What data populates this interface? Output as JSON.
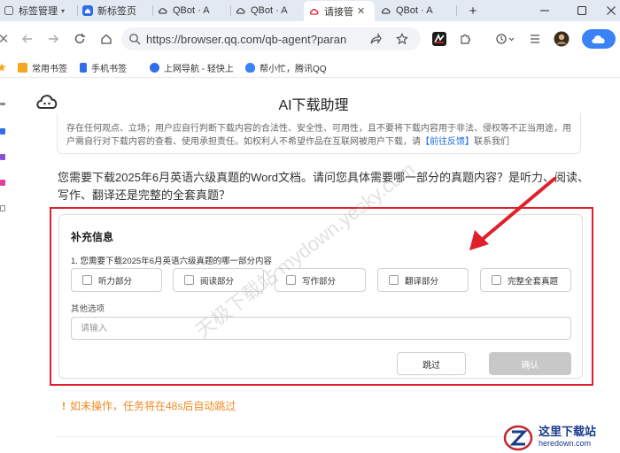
{
  "tabs": [
    {
      "label": "标签管理",
      "has_dropdown": true
    },
    {
      "label": "新标签页"
    },
    {
      "label": "QBot · A"
    },
    {
      "label": "QBot · A"
    },
    {
      "label": "请接管",
      "active": true
    },
    {
      "label": "QBot · A"
    }
  ],
  "new_tab_symbol": "+",
  "nav": {
    "url": "https://browser.qq.com/qb-agent?paran"
  },
  "bookmarks": [
    {
      "label": "常用书签"
    },
    {
      "label": "手机书签"
    },
    {
      "label": "上网导航 - 轻快上"
    },
    {
      "label": "帮小忙，腾讯QQ"
    }
  ],
  "page": {
    "title": "AI下载助理",
    "disclaimer_line1": "存在任何观点、立场；用户应自行判断下载内容的合法性、安全性、可用性，且不要将下载内容用于非法、侵权等不正当用途，用",
    "disclaimer_line2_pre": "户需自行对下载内容的查看、使用承担责任。如权利人不希望作品在互联网被用户下载，请",
    "disclaimer_link": "【前往反馈】",
    "disclaimer_line2_post": "联系我们",
    "assistant_message": "您需要下载2025年6月英语六级真题的Word文档。请问您具体需要哪一部分的真题内容？是听力、阅读、写作、翻译还是完整的全套真题？"
  },
  "form": {
    "title": "补充信息",
    "question": "1. 您需要下载2025年6月英语六级真题的哪一部分内容",
    "options": [
      "听力部分",
      "阅读部分",
      "写作部分",
      "翻译部分",
      "完整全套真题"
    ],
    "other_label": "其他选项",
    "other_placeholder": "请输入",
    "skip_label": "跳过",
    "confirm_label": "确认"
  },
  "warning": {
    "icon": "!",
    "text": "如未操作，任务将在48s后自动跳过"
  },
  "watermark": {
    "text": "天极下载站 mydown.yesky.com",
    "logo_text": "这里下载站",
    "logo_sub": "heredown.com"
  },
  "colors": {
    "accent": "#1f6fe5",
    "highlight": "#e0202a",
    "warning": "#f08a24",
    "confirm_disabled": "#c8c8c8",
    "cloud_button": "#3b82f6"
  }
}
